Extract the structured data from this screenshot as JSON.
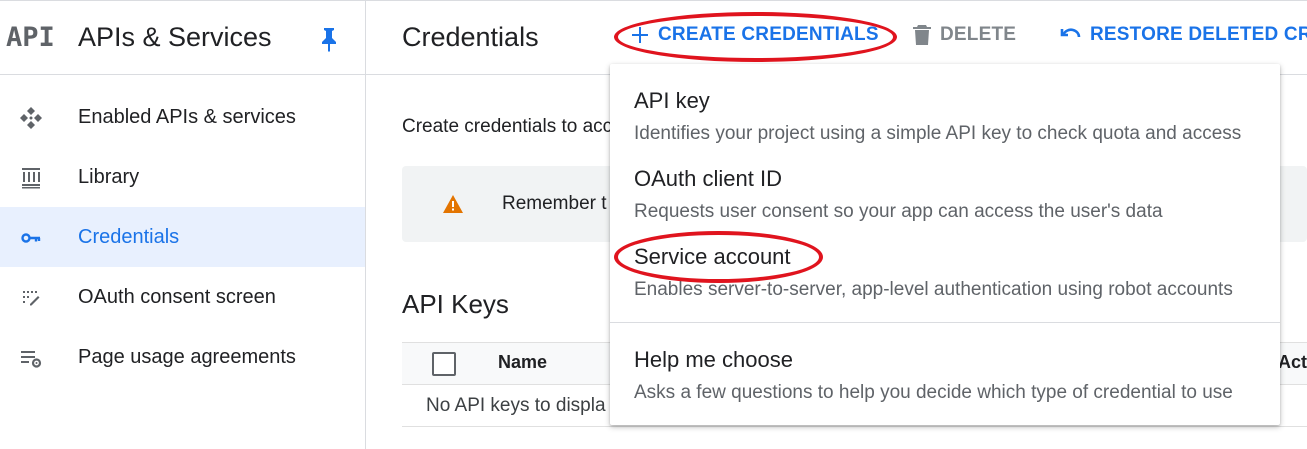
{
  "sidebar": {
    "logo": "API",
    "title": "APIs & Services",
    "items": [
      {
        "label": "Enabled APIs & services",
        "icon": "enabled-apis-icon"
      },
      {
        "label": "Library",
        "icon": "library-icon"
      },
      {
        "label": "Credentials",
        "icon": "key-icon",
        "active": true
      },
      {
        "label": "OAuth consent screen",
        "icon": "oauth-consent-icon"
      },
      {
        "label": "Page usage agreements",
        "icon": "page-settings-icon"
      }
    ]
  },
  "header": {
    "title": "Credentials",
    "create_label": "CREATE CREDENTIALS",
    "delete_label": "DELETE",
    "restore_label": "RESTORE DELETED CRED"
  },
  "main": {
    "intro": "Create credentials to acc",
    "banner_text": "Remember t",
    "api_keys_title": "API Keys",
    "table": {
      "columns": [
        "Name",
        "Actio"
      ],
      "empty": "No API keys to displa"
    }
  },
  "menu": {
    "items": [
      {
        "title": "API key",
        "desc": "Identifies your project using a simple API key to check quota and access"
      },
      {
        "title": "OAuth client ID",
        "desc": "Requests user consent so your app can access the user's data"
      },
      {
        "title": "Service account",
        "desc": "Enables server-to-server, app-level authentication using robot accounts"
      },
      {
        "title": "Help me choose",
        "desc": "Asks a few questions to help you decide which type of credential to use"
      }
    ]
  },
  "colors": {
    "accent": "#1a73e8",
    "annotation": "#e0141e",
    "warning": "#e37400",
    "active_bg": "#e8f0fe"
  }
}
